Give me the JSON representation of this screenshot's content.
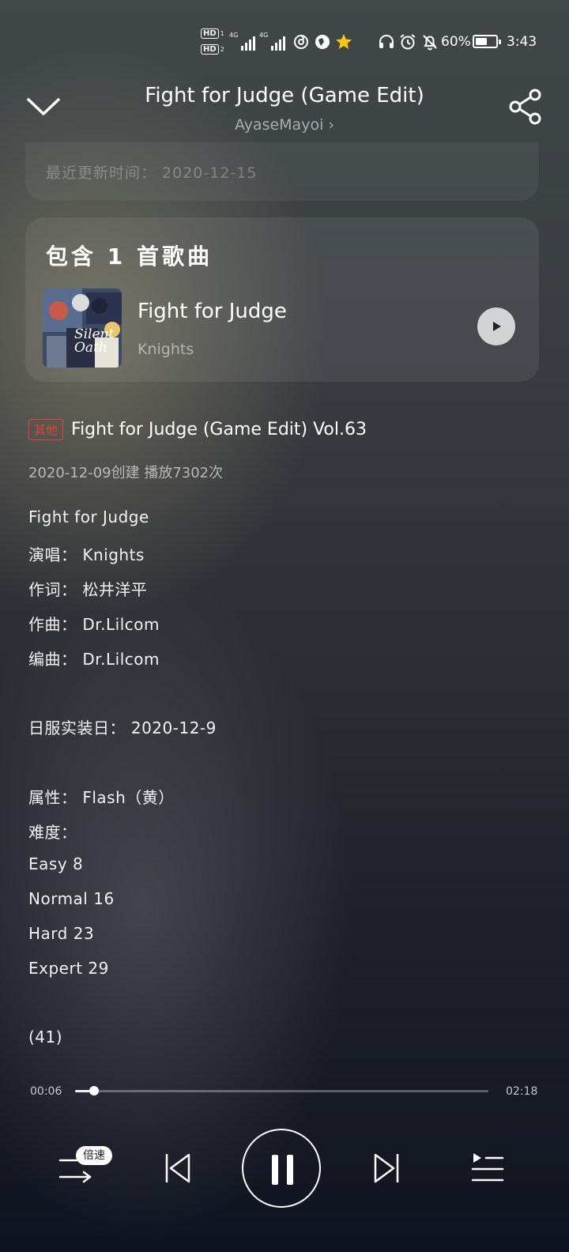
{
  "status_bar": {
    "hd1": "HD",
    "hd1_sub": "1",
    "hd2": "HD",
    "hd2_sub": "2",
    "signal1_tag": "4G",
    "signal2_tag": "4G",
    "battery_text": "60%",
    "battery_level": 0.6,
    "time": "3:43",
    "icons": [
      "hd-icon",
      "signal-icon",
      "signal-icon",
      "nfc-icon",
      "browser-icon",
      "star-icon",
      "headset-icon",
      "alarm-icon",
      "mute-bell-icon",
      "battery-icon"
    ]
  },
  "header": {
    "title": "Fight for Judge (Game Edit)",
    "artist": "AyaseMayoi"
  },
  "update": {
    "text": "最近更新时间： 2020-12-15"
  },
  "songs": {
    "heading": "包含 1 首歌曲",
    "items": [
      {
        "name": "Fight for Judge",
        "artist": "Knights",
        "cover_text": "Silent Oath"
      }
    ]
  },
  "description": {
    "tag": "其他",
    "title": "Fight for Judge (Game Edit) Vol.63",
    "meta": "2020-12-09创建 播放7302次",
    "lines": [
      "Fight for Judge",
      "演唱： Knights",
      "作词： 松井洋平",
      "作曲： Dr.Lilcom",
      "编曲： Dr.Lilcom",
      "日服实装日： 2020-12-9",
      "属性： Flash（黄）",
      "难度：",
      "Easy 8",
      "Normal 16",
      "Hard 23",
      "Expert 29",
      "(41)"
    ]
  },
  "player": {
    "current_time": "00:06",
    "total_time": "02:18",
    "progress": 0.045,
    "speed_label": "倍速",
    "accent": "#e2423a"
  }
}
